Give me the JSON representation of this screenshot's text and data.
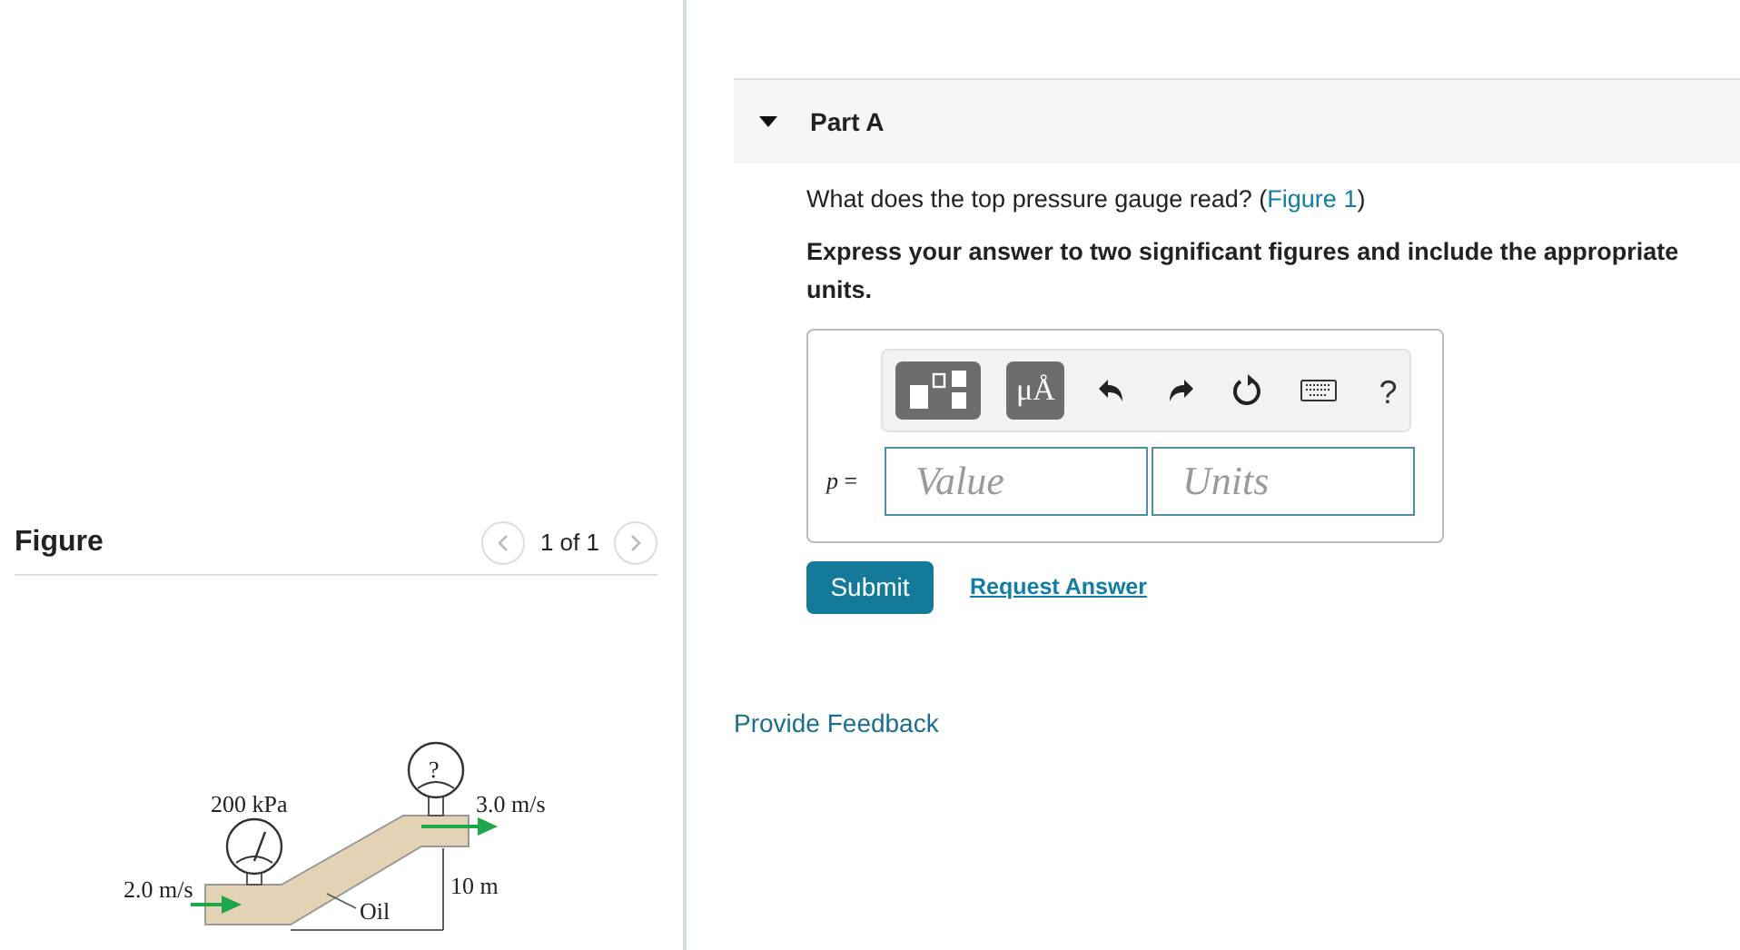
{
  "part": {
    "title": "Part A",
    "expanded": true
  },
  "question": {
    "text_before": "What does the top pressure gauge read? (",
    "link": "Figure 1",
    "text_after": ")"
  },
  "instruction": "Express your answer to two significant figures and include the appropriate units.",
  "toolbar": [
    {
      "kind": "templates"
    },
    {
      "kind": "units",
      "label": "μÅ"
    },
    {
      "kind": "undo"
    },
    {
      "kind": "redo"
    },
    {
      "kind": "reset"
    },
    {
      "kind": "keyboard"
    },
    {
      "kind": "help",
      "label": "?"
    }
  ],
  "answer": {
    "variable": "p",
    "equals": "=",
    "value_placeholder": "Value",
    "units_placeholder": "Units"
  },
  "submit": "Submit",
  "request_answer": "Request Answer",
  "feedback": "Provide Feedback",
  "figure": {
    "title": "Figure",
    "pager": "1 of 1",
    "labels": {
      "bottom_gauge": "200 kPa",
      "top_gauge": "?",
      "outlet_speed": "3.0 m/s",
      "inlet_speed": "2.0 m/s",
      "height": "10 m",
      "fluid": "Oil"
    }
  }
}
